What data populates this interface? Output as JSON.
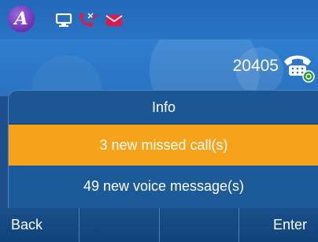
{
  "status_bar": {
    "icons": [
      "alcatel-logo",
      "display-icon",
      "missed-call-icon",
      "mail-icon"
    ],
    "colors": {
      "logo": "#7a3fc4",
      "missed_call": "#e0194b",
      "mail": "#e0194b"
    }
  },
  "line": {
    "extension": "20405"
  },
  "popup": {
    "title": "Info",
    "items": [
      {
        "label": "3 new missed call(s)",
        "selected": true
      },
      {
        "label": "49 new voice message(s)",
        "selected": false
      }
    ]
  },
  "softkeys": [
    "Back",
    "",
    "",
    "Enter"
  ],
  "colors": {
    "accent": "#f7a21b",
    "panel": "#1d5a9a",
    "bar": "#2a72c0"
  }
}
